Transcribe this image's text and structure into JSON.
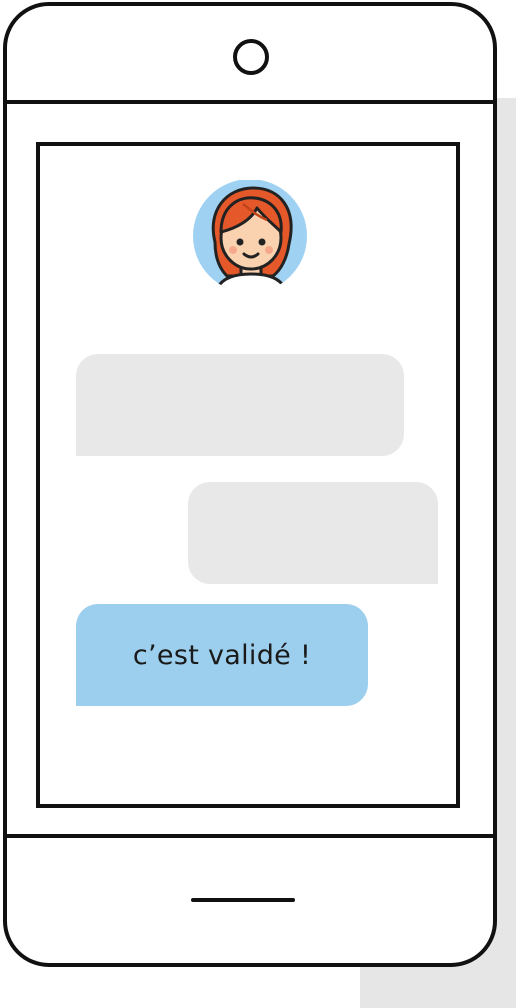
{
  "conversation": {
    "avatar_icon": "woman-redhead-avatar-icon",
    "messages": [
      {
        "side": "left",
        "style": "placeholder",
        "text": ""
      },
      {
        "side": "right",
        "style": "placeholder",
        "text": ""
      },
      {
        "side": "left",
        "style": "highlight",
        "text": "c’est validé !"
      }
    ]
  },
  "colors": {
    "outline": "#111111",
    "shadow": "#e6e6e6",
    "placeholder_bubble": "#e8e8e8",
    "highlight_bubble": "#9ccfee",
    "avatar_background": "#9fd2f2",
    "hair": "#e4582a",
    "skin": "#fbd2b0"
  }
}
